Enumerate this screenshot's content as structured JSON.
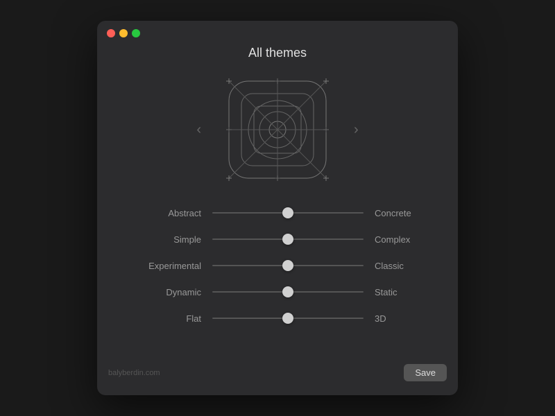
{
  "window": {
    "title": "All themes",
    "traffic_lights": {
      "close": "close",
      "minimize": "minimize",
      "maximize": "maximize"
    }
  },
  "nav": {
    "prev_arrow": "‹",
    "next_arrow": "›"
  },
  "sliders": [
    {
      "id": "abstract-concrete",
      "left_label": "Abstract",
      "right_label": "Concrete",
      "value": 50
    },
    {
      "id": "simple-complex",
      "left_label": "Simple",
      "right_label": "Complex",
      "value": 50
    },
    {
      "id": "experimental-classic",
      "left_label": "Experimental",
      "right_label": "Classic",
      "value": 50
    },
    {
      "id": "dynamic-static",
      "left_label": "Dynamic",
      "right_label": "Static",
      "value": 50
    },
    {
      "id": "flat-3d",
      "left_label": "Flat",
      "right_label": "3D",
      "value": 50
    }
  ],
  "footer": {
    "credit": "balyberdin.com",
    "save_label": "Save"
  }
}
